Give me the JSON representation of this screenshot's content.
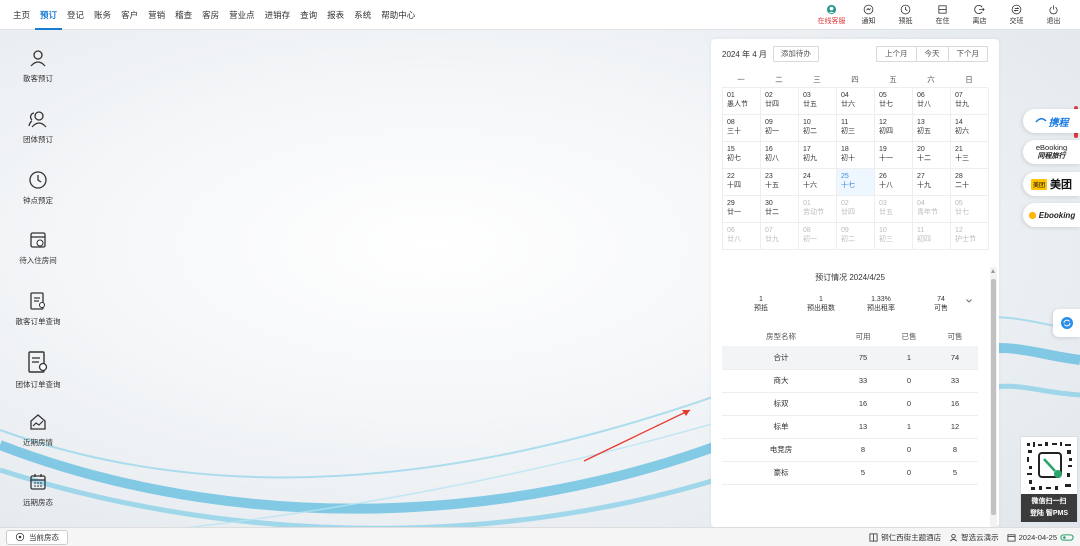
{
  "menu": [
    "主页",
    "预订",
    "登记",
    "账务",
    "客户",
    "营销",
    "稽查",
    "客房",
    "营业点",
    "进销存",
    "查询",
    "报表",
    "系统",
    "帮助中心"
  ],
  "active_menu_index": 1,
  "tools": [
    {
      "label": "在线客服",
      "icon": "support-icon",
      "color": "#e23a3a"
    },
    {
      "label": "通知",
      "icon": "notice-icon"
    },
    {
      "label": "预抵",
      "icon": "clock-icon"
    },
    {
      "label": "在住",
      "icon": "bed-icon"
    },
    {
      "label": "离店",
      "icon": "exit-icon"
    },
    {
      "label": "交班",
      "icon": "shift-icon"
    },
    {
      "label": "退出",
      "icon": "power-icon"
    }
  ],
  "sidebar": [
    {
      "label": "散客预订",
      "icon": "user-icon"
    },
    {
      "label": "团体预订",
      "icon": "group-icon"
    },
    {
      "label": "钟点预定",
      "icon": "clock-icon"
    },
    {
      "label": "待入住房间",
      "icon": "calendar-room-icon"
    },
    {
      "label": "散客订单查询",
      "icon": "order-search-icon"
    },
    {
      "label": "团体订单查询",
      "icon": "group-order-icon"
    },
    {
      "label": "近期房情",
      "icon": "trend-icon"
    },
    {
      "label": "远期房态",
      "icon": "calendar-icon"
    }
  ],
  "calendar": {
    "title": "2024 年 4 月",
    "add_button": "添加待办",
    "prev_button": "上个月",
    "today_button": "今天",
    "next_button": "下个月",
    "weekdays": [
      "一",
      "二",
      "三",
      "四",
      "五",
      "六",
      "日"
    ],
    "days": [
      {
        "d": "01",
        "l": "愚人节"
      },
      {
        "d": "02",
        "l": "廿四"
      },
      {
        "d": "03",
        "l": "廿五"
      },
      {
        "d": "04",
        "l": "廿六"
      },
      {
        "d": "05",
        "l": "廿七"
      },
      {
        "d": "06",
        "l": "廿八"
      },
      {
        "d": "07",
        "l": "廿九"
      },
      {
        "d": "08",
        "l": "三十"
      },
      {
        "d": "09",
        "l": "初一"
      },
      {
        "d": "10",
        "l": "初二"
      },
      {
        "d": "11",
        "l": "初三"
      },
      {
        "d": "12",
        "l": "初四"
      },
      {
        "d": "13",
        "l": "初五"
      },
      {
        "d": "14",
        "l": "初六"
      },
      {
        "d": "15",
        "l": "初七"
      },
      {
        "d": "16",
        "l": "初八"
      },
      {
        "d": "17",
        "l": "初九"
      },
      {
        "d": "18",
        "l": "初十"
      },
      {
        "d": "19",
        "l": "十一"
      },
      {
        "d": "20",
        "l": "十二"
      },
      {
        "d": "21",
        "l": "十三"
      },
      {
        "d": "22",
        "l": "十四"
      },
      {
        "d": "23",
        "l": "十五"
      },
      {
        "d": "24",
        "l": "十六"
      },
      {
        "d": "25",
        "l": "十七",
        "today": true
      },
      {
        "d": "26",
        "l": "十八"
      },
      {
        "d": "27",
        "l": "十九"
      },
      {
        "d": "28",
        "l": "二十"
      },
      {
        "d": "29",
        "l": "廿一"
      },
      {
        "d": "30",
        "l": "廿二"
      },
      {
        "d": "01",
        "l": "劳动节",
        "other": true
      },
      {
        "d": "02",
        "l": "廿四",
        "other": true
      },
      {
        "d": "03",
        "l": "廿五",
        "other": true
      },
      {
        "d": "04",
        "l": "青年节",
        "other": true
      },
      {
        "d": "05",
        "l": "廿七",
        "other": true
      },
      {
        "d": "06",
        "l": "廿八",
        "other": true
      },
      {
        "d": "07",
        "l": "廿九",
        "other": true
      },
      {
        "d": "08",
        "l": "初一",
        "other": true
      },
      {
        "d": "09",
        "l": "初二",
        "other": true
      },
      {
        "d": "10",
        "l": "初三",
        "other": true
      },
      {
        "d": "11",
        "l": "初四",
        "other": true
      },
      {
        "d": "12",
        "l": "护士节",
        "other": true
      }
    ]
  },
  "booking": {
    "title": "预订情况 2024/4/25",
    "stats": [
      {
        "value": "1",
        "label": "预抵"
      },
      {
        "value": "1",
        "label": "预出租数"
      },
      {
        "value": "1.33%",
        "label": "预出租率"
      },
      {
        "value": "74",
        "label": "可售"
      }
    ],
    "headers": [
      "房型名称",
      "可用",
      "已售",
      "可售"
    ],
    "rows": [
      {
        "name": "合计",
        "available": "75",
        "sold": "1",
        "sellable": "74",
        "summary": true
      },
      {
        "name": "商大",
        "available": "33",
        "sold": "0",
        "sellable": "33"
      },
      {
        "name": "标双",
        "available": "16",
        "sold": "0",
        "sellable": "16"
      },
      {
        "name": "标单",
        "available": "13",
        "sold": "1",
        "sellable": "12"
      },
      {
        "name": "电竞房",
        "available": "8",
        "sold": "0",
        "sellable": "8"
      },
      {
        "name": "豪标",
        "available": "5",
        "sold": "0",
        "sellable": "5"
      }
    ]
  },
  "ota": {
    "ctrip": "携程",
    "ebooking_top": "eBooking",
    "ebooking_bottom": "同程旅行",
    "meituan_box": "美团",
    "meituan": "美团",
    "ebooking2": "Ebooking"
  },
  "qr": {
    "line1": "微信扫一扫",
    "line2": "登陆 智PMS"
  },
  "bottom": {
    "current_status": "当前房态",
    "hotel": "铜仁西街主题酒店",
    "user": "智选云演示",
    "date": "2024-04-25"
  },
  "colors": {
    "accent": "#1a7bd4",
    "alert": "#e23a3a",
    "today": "#3b8fe0"
  }
}
